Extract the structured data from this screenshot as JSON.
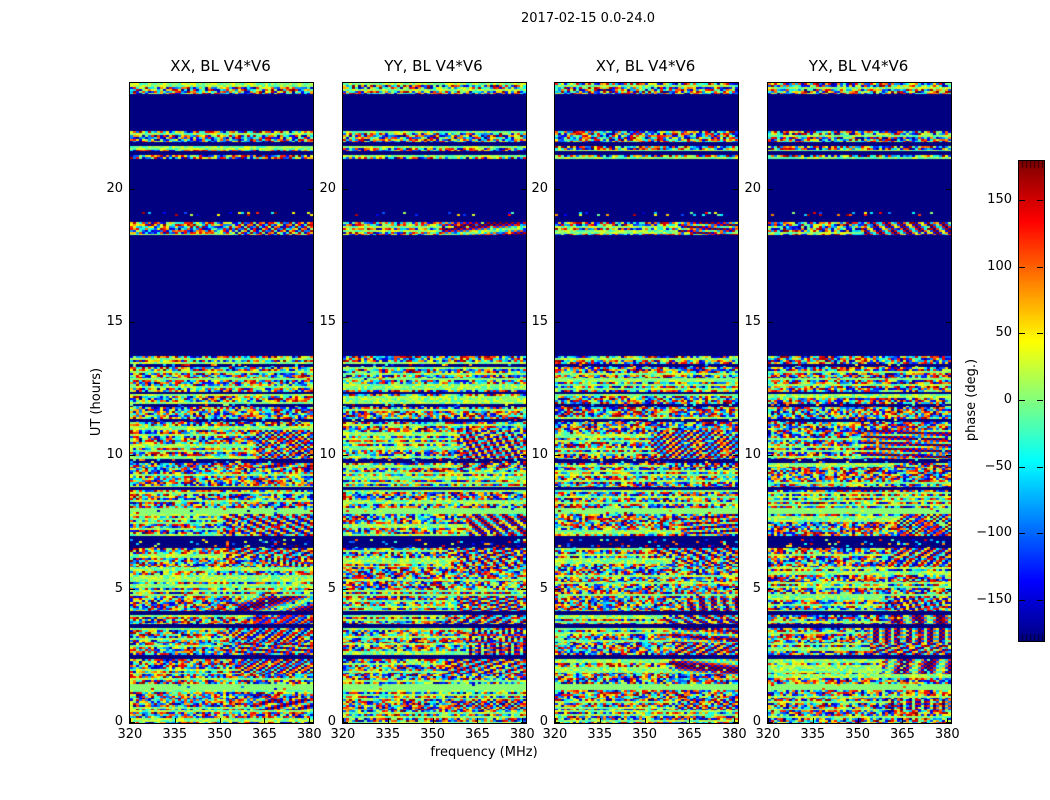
{
  "figure": {
    "title": "2017-02-15 0.0-24.0",
    "background": "#ffffff",
    "solid_color": "#000080",
    "green_color": "#8aff80"
  },
  "chart_data": {
    "type": "heatmap",
    "title": "2017-02-15 0.0-24.0",
    "xlabel": "frequency (MHz)",
    "ylabel": "UT (hours)",
    "colorbar_label": "phase (deg.)",
    "colormap": "jet",
    "grid": false,
    "panels": [
      {
        "label": "XX, BL V4*V6"
      },
      {
        "label": "YY, BL V4*V6"
      },
      {
        "label": "XY, BL V4*V6"
      },
      {
        "label": "YX, BL V4*V6"
      }
    ],
    "x_ticks": [
      "320",
      "335",
      "350",
      "365",
      "380"
    ],
    "x_tick_values": [
      320,
      335,
      350,
      365,
      380
    ],
    "x_range": [
      319.7,
      380.9
    ],
    "y_ticks": [
      "0",
      "5",
      "10",
      "15",
      "20"
    ],
    "y_tick_values": [
      0,
      5,
      10,
      15,
      20
    ],
    "y_range": [
      0,
      24
    ],
    "colorbar_ticks": [
      "150",
      "100",
      "50",
      "0",
      "−50",
      "−100",
      "−150"
    ],
    "colorbar_tick_values": [
      150,
      100,
      50,
      0,
      -50,
      -100,
      -150
    ],
    "colorbar_range": [
      -180,
      180
    ],
    "bands": [
      {
        "t0": 24.0,
        "t1": 23.6,
        "type": "noise"
      },
      {
        "t0": 23.6,
        "t1": 22.2,
        "type": "solid"
      },
      {
        "t0": 22.2,
        "t1": 21.8,
        "type": "noise"
      },
      {
        "t0": 21.8,
        "t1": 21.65,
        "type": "solid"
      },
      {
        "t0": 21.65,
        "t1": 21.45,
        "type": "noise"
      },
      {
        "t0": 21.45,
        "t1": 21.3,
        "type": "solid"
      },
      {
        "t0": 21.3,
        "t1": 21.15,
        "type": "noise"
      },
      {
        "t0": 21.15,
        "t1": 19.15,
        "type": "solid"
      },
      {
        "t0": 19.15,
        "t1": 19.0,
        "type": "sparse"
      },
      {
        "t0": 19.0,
        "t1": 18.8,
        "type": "solid"
      },
      {
        "t0": 18.8,
        "t1": 18.3,
        "type": "fringe"
      },
      {
        "t0": 18.3,
        "t1": 13.75,
        "type": "solid"
      },
      {
        "t0": 13.75,
        "t1": 13.45,
        "type": "noise"
      },
      {
        "t0": 13.45,
        "t1": 13.35,
        "type": "sparse"
      },
      {
        "t0": 13.35,
        "t1": 12.95,
        "type": "noise"
      },
      {
        "t0": 12.95,
        "t1": 12.88,
        "type": "green"
      },
      {
        "t0": 12.88,
        "t1": 12.42,
        "type": "noise"
      },
      {
        "t0": 12.42,
        "t1": 12.32,
        "type": "solid"
      },
      {
        "t0": 12.32,
        "t1": 11.95,
        "type": "noise"
      },
      {
        "t0": 11.95,
        "t1": 11.85,
        "type": "sparse"
      },
      {
        "t0": 11.85,
        "t1": 11.4,
        "type": "noise"
      },
      {
        "t0": 11.4,
        "t1": 11.3,
        "type": "sparse"
      },
      {
        "t0": 11.3,
        "t1": 11.0,
        "type": "noise"
      },
      {
        "t0": 11.0,
        "t1": 9.9,
        "type": "fringe"
      },
      {
        "t0": 9.9,
        "t1": 9.75,
        "type": "sparse"
      },
      {
        "t0": 9.75,
        "t1": 9.55,
        "type": "fringe"
      },
      {
        "t0": 9.55,
        "t1": 9.2,
        "type": "noise"
      },
      {
        "t0": 9.2,
        "t1": 8.85,
        "type": "noise"
      },
      {
        "t0": 8.85,
        "t1": 8.75,
        "type": "solid"
      },
      {
        "t0": 8.75,
        "t1": 8.05,
        "type": "noise"
      },
      {
        "t0": 8.05,
        "t1": 7.85,
        "type": "green"
      },
      {
        "t0": 7.85,
        "t1": 7.0,
        "type": "fringe"
      },
      {
        "t0": 7.0,
        "t1": 6.9,
        "type": "solid"
      },
      {
        "t0": 6.9,
        "t1": 6.55,
        "type": "sparse"
      },
      {
        "t0": 6.55,
        "t1": 6.2,
        "type": "fringe"
      },
      {
        "t0": 6.2,
        "t1": 5.85,
        "type": "fringe"
      },
      {
        "t0": 5.85,
        "t1": 5.3,
        "type": "noise"
      },
      {
        "t0": 5.3,
        "t1": 4.85,
        "type": "noise"
      },
      {
        "t0": 4.85,
        "t1": 4.75,
        "type": "green"
      },
      {
        "t0": 4.75,
        "t1": 4.2,
        "type": "fringe"
      },
      {
        "t0": 4.2,
        "t1": 4.05,
        "type": "solid"
      },
      {
        "t0": 4.05,
        "t1": 3.7,
        "type": "fringe"
      },
      {
        "t0": 3.7,
        "t1": 3.55,
        "type": "solid"
      },
      {
        "t0": 3.55,
        "t1": 3.0,
        "type": "fringe"
      },
      {
        "t0": 3.0,
        "t1": 2.55,
        "type": "fringe"
      },
      {
        "t0": 2.55,
        "t1": 2.4,
        "type": "solid"
      },
      {
        "t0": 2.4,
        "t1": 1.85,
        "type": "fringe"
      },
      {
        "t0": 1.85,
        "t1": 1.45,
        "type": "noise"
      },
      {
        "t0": 1.45,
        "t1": 1.25,
        "type": "green"
      },
      {
        "t0": 1.25,
        "t1": 0.9,
        "type": "noise"
      },
      {
        "t0": 0.9,
        "t1": 0.5,
        "type": "fringe"
      },
      {
        "t0": 0.5,
        "t1": 0.0,
        "type": "noise"
      }
    ]
  }
}
